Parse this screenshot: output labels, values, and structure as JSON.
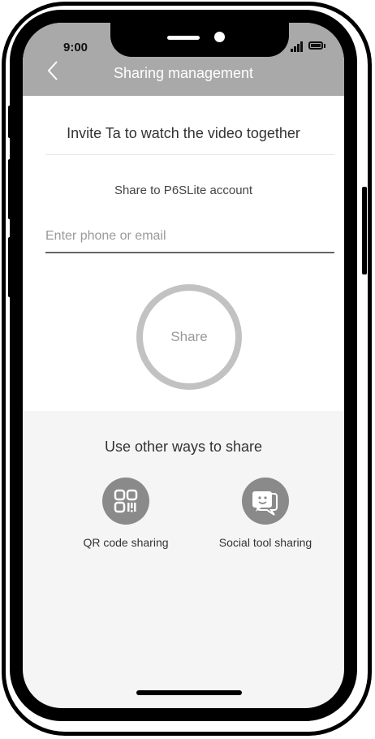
{
  "status_bar": {
    "time": "9:00",
    "signal_icon": "cellular-signal-icon",
    "battery_icon": "battery-icon"
  },
  "nav": {
    "back_icon": "chevron-left-icon",
    "title": "Sharing management"
  },
  "invite": {
    "title": "Invite Ta to watch the video together",
    "share_to": "Share to P6SLite account",
    "input_placeholder": "Enter phone or email",
    "input_value": "",
    "share_button": "Share"
  },
  "other_ways": {
    "title": "Use other ways to share",
    "options": [
      {
        "label": "QR code sharing",
        "icon": "qr-code-icon"
      },
      {
        "label": "Social tool sharing",
        "icon": "chat-bubbles-icon"
      }
    ]
  },
  "colors": {
    "navbar": "#a9a9a9",
    "share_ring": "#c2c2c2",
    "option_icon_bg": "#8a8a8a",
    "page_bg": "#f5f5f5"
  }
}
